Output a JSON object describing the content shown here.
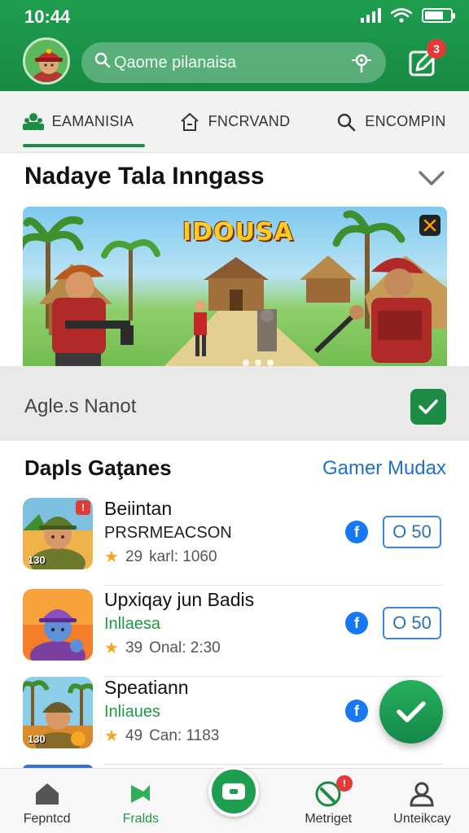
{
  "status_bar": {
    "time": "10:44"
  },
  "header": {
    "search": {
      "placeholder": "Qaome pilanaisa"
    },
    "notification_count": "3"
  },
  "tabs": [
    {
      "label": "EAMANISIA",
      "icon": "people-icon",
      "active": true
    },
    {
      "label": "FNCRVAND",
      "icon": "house-icon",
      "active": false
    },
    {
      "label": "ENCOMPIN",
      "icon": "search-icon",
      "active": false
    }
  ],
  "featured": {
    "title": "Nadaye Tala Inngass",
    "banner_logo": "IDOUSA",
    "banner_corner_icon": "x-logo-icon",
    "footer_label": "Agle.s Nanot"
  },
  "list": {
    "title": "Dapls Gaţanes",
    "link": "Gamer Mudax",
    "items": [
      {
        "name": "Beiintan",
        "subtitle": "PRSRMEACSON",
        "subtitle_style": "dark",
        "rating": "29",
        "meta": "karl: 1060",
        "price": "O 50",
        "thumb_badge": "!",
        "thumb_label": "130"
      },
      {
        "name": "Upxiqay jun Badis",
        "subtitle": "Inllaesa",
        "subtitle_style": "green",
        "rating": "39",
        "meta": "Onal: 2:30",
        "price": "O 50",
        "thumb_badge": "",
        "thumb_label": ""
      },
      {
        "name": "Speatiann",
        "subtitle": "Inliaues",
        "subtitle_style": "green",
        "rating": "49",
        "meta": "Can: 1183",
        "price": "",
        "thumb_badge": "",
        "thumb_label": "130"
      }
    ]
  },
  "bottom_nav": [
    {
      "label": "Fepntcd",
      "icon": "home-icon"
    },
    {
      "label": "Fralds",
      "icon": "flag-icon",
      "active": true
    },
    {
      "label": "",
      "icon": "center-game-icon"
    },
    {
      "label": "Metriget",
      "icon": "leaf-icon",
      "badge": "!"
    },
    {
      "label": "Unteikcay",
      "icon": "user-icon"
    }
  ],
  "colors": {
    "header_green": "#1e9e4f",
    "accent_blue": "#1f6fd1",
    "badge_red": "#e53935",
    "fab_green": "#14884a"
  }
}
